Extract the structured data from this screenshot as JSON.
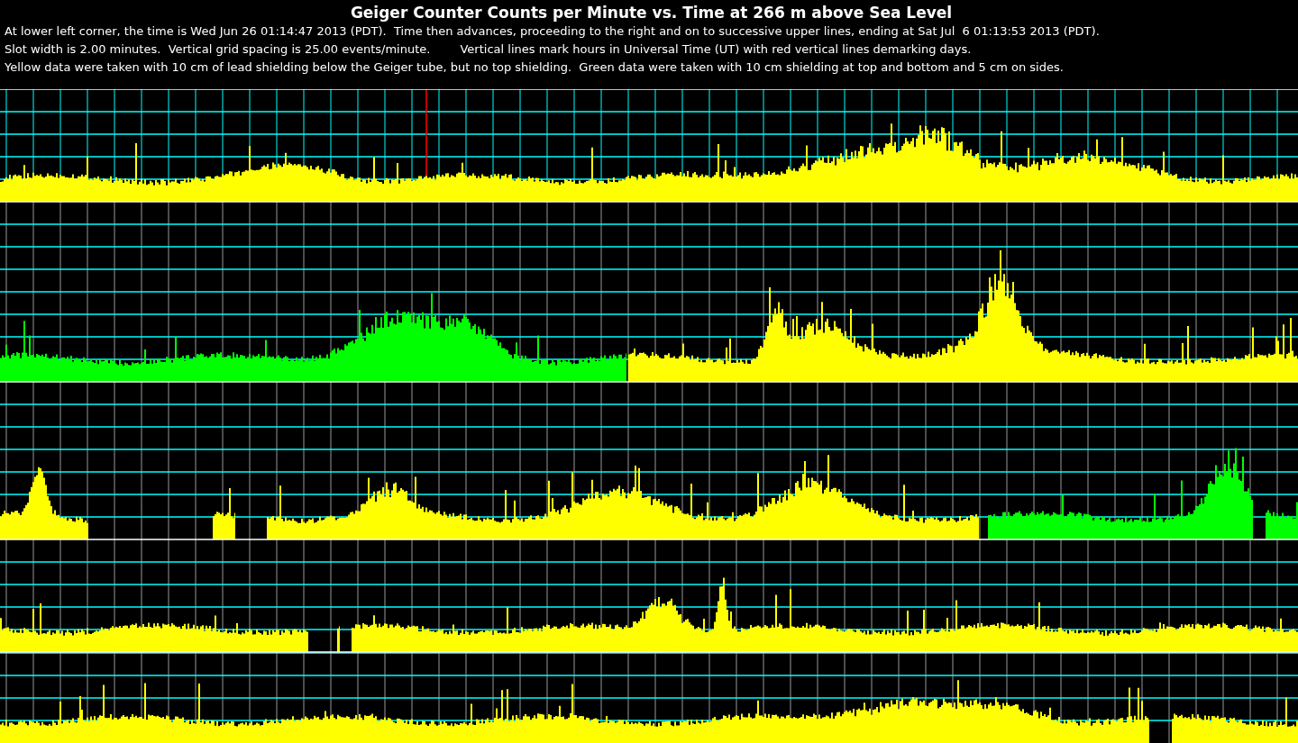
{
  "title": "Geiger Counter Counts per Minute vs. Time at 266 m above Sea Level",
  "notes": [
    "At lower left corner, the time is Wed Jun 26 01:14:47 2013 (PDT).  Time then advances, proceeding to the right and on to successive upper lines, ending at Sat Jul  6 01:13:53 2013 (PDT).",
    "Slot width is 2.00 minutes.  Vertical grid spacing is 25.00 events/minute.        Vertical lines mark hours in Universal Time (UT) with red vertical lines demarking days.",
    "Yellow data were taken with 10 cm of lead shielding below the Geiger tube, but no top shielding.  Green data were taken with 10 cm shielding at top and bottom and 5 cm on sides."
  ]
}
